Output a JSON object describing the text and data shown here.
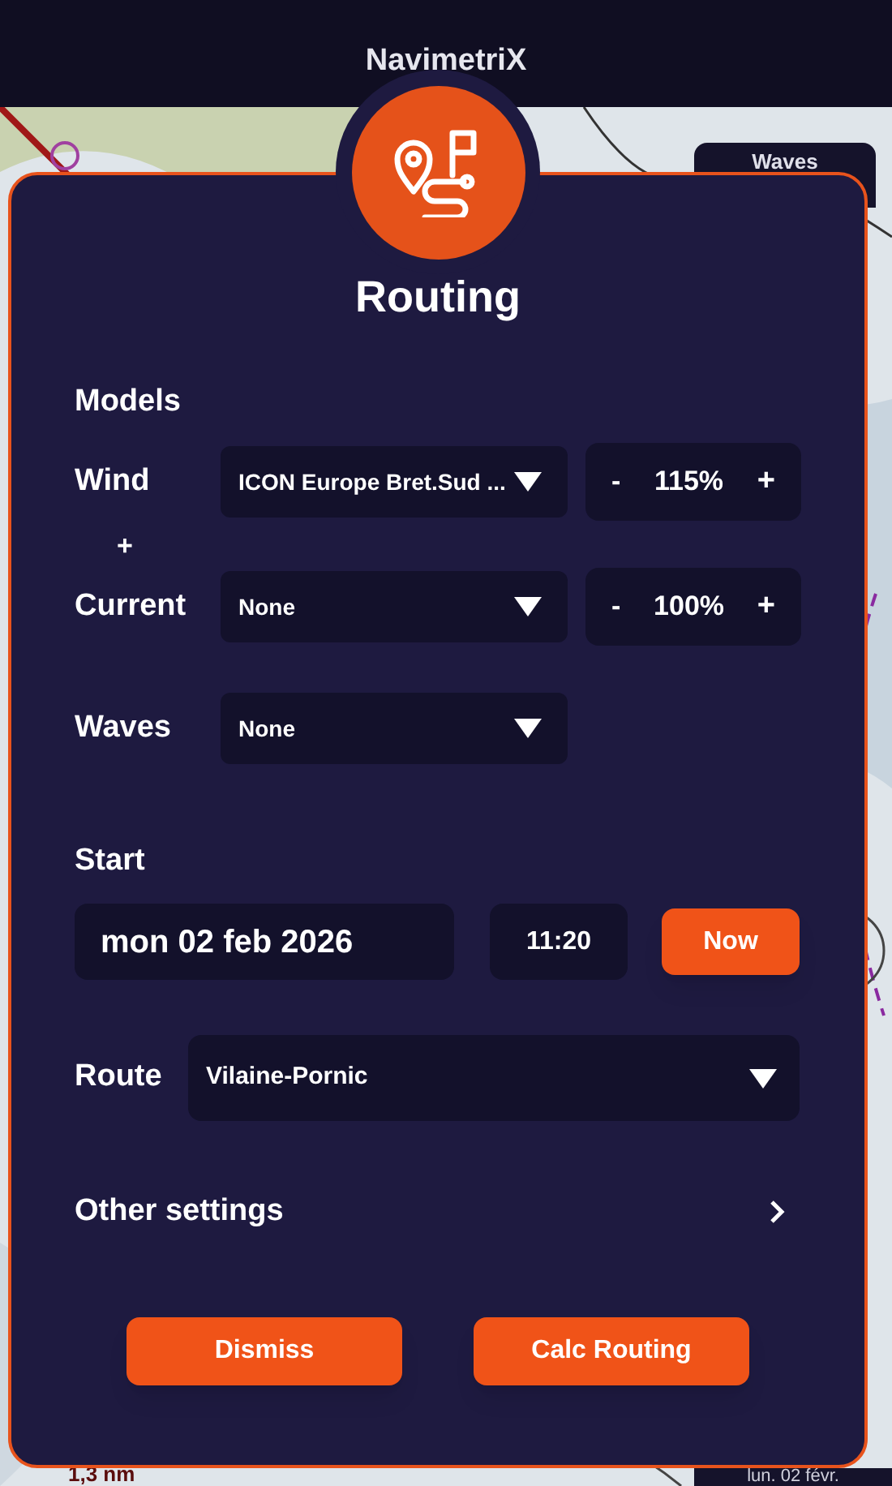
{
  "header": {
    "title": "NavimetriX"
  },
  "map_overlays": {
    "waves_label": "Waves",
    "scale": "1,3 nm",
    "date": "lun. 02 févr."
  },
  "dialog": {
    "title": "Routing",
    "models_heading": "Models",
    "models": [
      {
        "kind": "row",
        "label": "Wind",
        "value": "ICON Europe Bret.Sud ...",
        "stepper": {
          "minus": "-",
          "reading": "115%",
          "plus": "+"
        }
      },
      {
        "kind": "joiner",
        "label": "+"
      },
      {
        "kind": "row",
        "label": "Current",
        "value": "None",
        "stepper": {
          "minus": "-",
          "reading": "100%",
          "plus": "+"
        }
      },
      {
        "kind": "row",
        "label": "Waves",
        "value": "None"
      }
    ],
    "start": {
      "heading": "Start",
      "date": "mon 02 feb 2026",
      "time": "11:20",
      "now_button": "Now"
    },
    "route": {
      "label": "Route",
      "value": "Vilaine-Pornic"
    },
    "other_settings": {
      "label": "Other settings"
    },
    "buttons": [
      "Dismiss",
      "Calc Routing"
    ]
  }
}
